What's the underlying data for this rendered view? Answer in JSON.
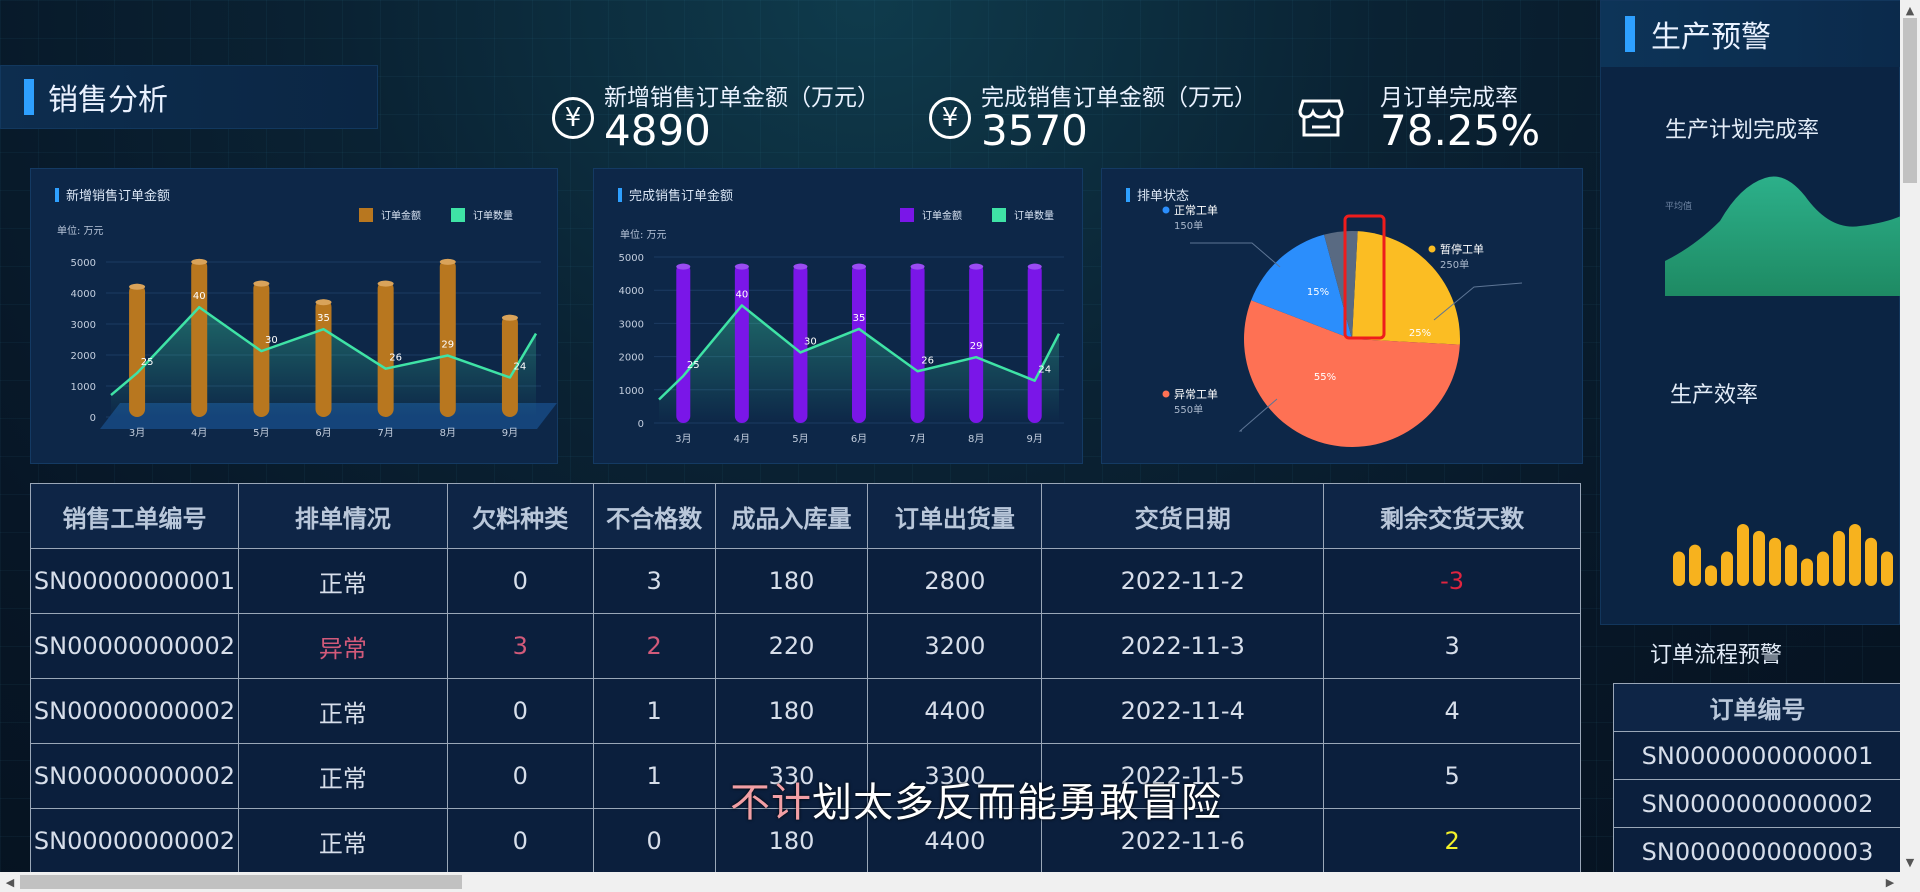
{
  "section_title": "销售分析",
  "stats": [
    {
      "label": "新增销售订单金额（万元）",
      "value": "4890",
      "icon": "yen-icon"
    },
    {
      "label": "完成销售订单金额（万元）",
      "value": "3570",
      "icon": "yen-icon"
    },
    {
      "label": "月订单完成率",
      "value": "78.25%",
      "icon": "store-icon"
    }
  ],
  "chart_data": [
    {
      "type": "bar",
      "title": "新增销售订单金额",
      "unit_label": "单位: 万元",
      "categories": [
        "3月",
        "4月",
        "5月",
        "6月",
        "7月",
        "8月",
        "9月"
      ],
      "yticks": [
        0,
        1000,
        2000,
        3000,
        4000,
        5000
      ],
      "ylim": [
        0,
        5000
      ],
      "series": [
        {
          "name": "订单金额",
          "type": "bar",
          "color": "#b8771f",
          "values": [
            4300,
            5100,
            4400,
            3800,
            4400,
            5100,
            3300
          ]
        },
        {
          "name": "订单数量",
          "type": "line",
          "color": "#3fe3a6",
          "values": [
            25,
            40,
            30,
            35,
            26,
            29,
            24
          ],
          "labels": [
            "25",
            "40",
            "30",
            "35",
            "26",
            "29",
            "24"
          ]
        }
      ]
    },
    {
      "type": "bar",
      "title": "完成销售订单金额",
      "unit_label": "单位: 万元",
      "categories": [
        "3月",
        "4月",
        "5月",
        "6月",
        "7月",
        "8月",
        "9月"
      ],
      "yticks": [
        0,
        1000,
        2000,
        3000,
        4000,
        5000
      ],
      "ylim": [
        0,
        5000
      ],
      "series": [
        {
          "name": "订单金额",
          "type": "bar",
          "color": "#7a16e8",
          "values": [
            4800,
            4800,
            4800,
            4800,
            4800,
            4800,
            4800
          ]
        },
        {
          "name": "订单数量",
          "type": "line",
          "color": "#3fe3a6",
          "values": [
            25,
            40,
            30,
            35,
            26,
            29,
            24
          ],
          "labels": [
            "25",
            "40",
            "30",
            "35",
            "26",
            "29",
            "24"
          ]
        }
      ]
    },
    {
      "type": "pie",
      "title": "排单状态",
      "slices": [
        {
          "name": "暂停工单",
          "count": "250单",
          "value": 25,
          "label": "25%",
          "color": "#fbbd23"
        },
        {
          "name": "异常工单",
          "count": "550单",
          "value": 55,
          "label": "55%",
          "color": "#fe7154"
        },
        {
          "name": "正常工单",
          "count": "150单",
          "value": 15,
          "label": "15%",
          "color": "#2b8efc"
        },
        {
          "name": "",
          "count": "",
          "value": 5,
          "label": "",
          "color": "#596a82"
        }
      ]
    }
  ],
  "table": {
    "headers": [
      "销售工单编号",
      "排单情况",
      "欠料种类",
      "不合格数",
      "成品入库量",
      "订单出货量",
      "交货日期",
      "剩余交货天数"
    ],
    "rows": [
      [
        "SN00000000001",
        "正常",
        "0",
        "3",
        "180",
        "2800",
        "2022-11-2",
        "-3"
      ],
      [
        "SN00000000002",
        "异常",
        "3",
        "2",
        "220",
        "3200",
        "2022-11-3",
        "3"
      ],
      [
        "SN00000000002",
        "正常",
        "0",
        "1",
        "180",
        "4400",
        "2022-11-4",
        "4"
      ],
      [
        "SN00000000002",
        "正常",
        "0",
        "1",
        "330",
        "3300",
        "2022-11-5",
        "5"
      ],
      [
        "SN00000000002",
        "正常",
        "0",
        "0",
        "180",
        "4400",
        "2022-11-6",
        "2"
      ]
    ]
  },
  "right_panel": {
    "title": "生产预警",
    "plan_rate_title": "生产计划完成率",
    "avg_label": "平均值",
    "efficiency_title": "生产效率",
    "efficiency_values": [
      5,
      6,
      3,
      5,
      9,
      8,
      7,
      6,
      4,
      5,
      8,
      9,
      7,
      5
    ]
  },
  "order_flow": {
    "title": "订单流程预警",
    "header": "订单编号",
    "rows": [
      "SN0000000000001",
      "SN0000000000002",
      "SN0000000000003"
    ]
  },
  "subtitle": {
    "highlight": "不计",
    "rest": "划太多反而能勇敢冒险"
  }
}
